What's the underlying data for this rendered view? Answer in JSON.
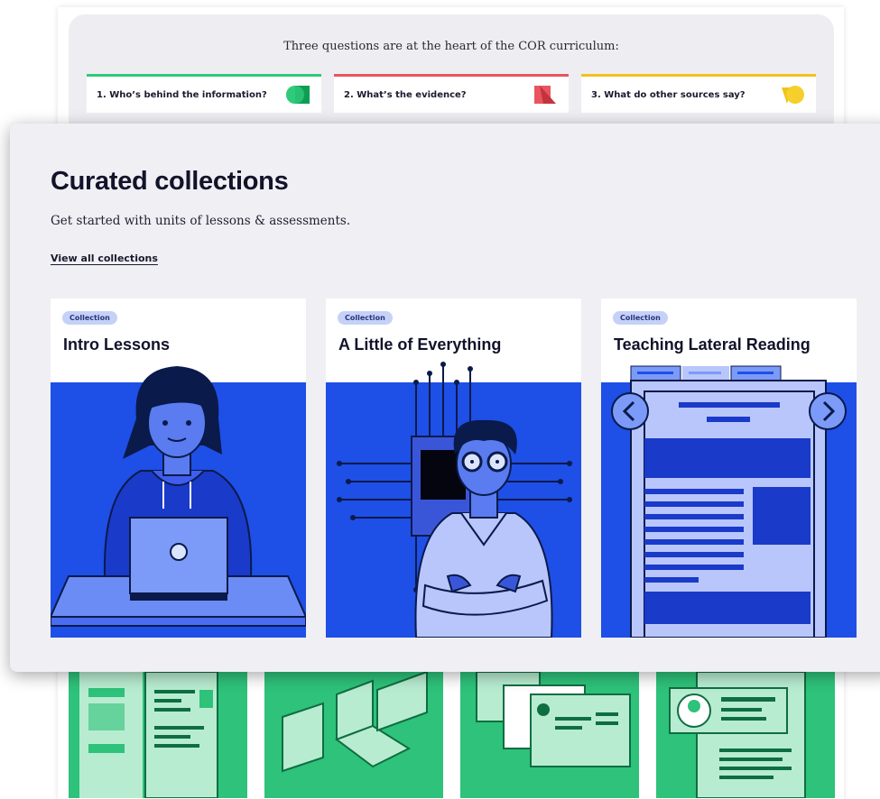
{
  "intro": {
    "text": "Three questions are at the heart of the COR curriculum:",
    "questions": [
      {
        "label": "1. Who’s behind the information?",
        "color": "#2ecb7a",
        "icon": "green-double-circle-icon"
      },
      {
        "label": "2. What’s the evidence?",
        "color": "#e8555f",
        "icon": "red-fold-shape-icon"
      },
      {
        "label": "3. What do other sources say?",
        "color": "#f2c11b",
        "icon": "yellow-circle-icon"
      }
    ]
  },
  "collections": {
    "title": "Curated collections",
    "subtitle": "Get started with units of lessons & assessments.",
    "view_all": "View all collections",
    "cards": [
      {
        "badge": "Collection",
        "title": "Intro Lessons",
        "illustration": "person-with-laptop-illustration"
      },
      {
        "badge": "Collection",
        "title": "A Little of Everything",
        "illustration": "person-with-circuit-chip-illustration"
      },
      {
        "badge": "Collection",
        "title": "Teaching Lateral Reading",
        "illustration": "webpage-carousel-illustration"
      }
    ]
  },
  "colors": {
    "accent_blue": "#1e4fe6",
    "accent_green": "#2ec27a",
    "badge_bg": "#c5d1f7",
    "panel_bg": "#efeff4"
  }
}
